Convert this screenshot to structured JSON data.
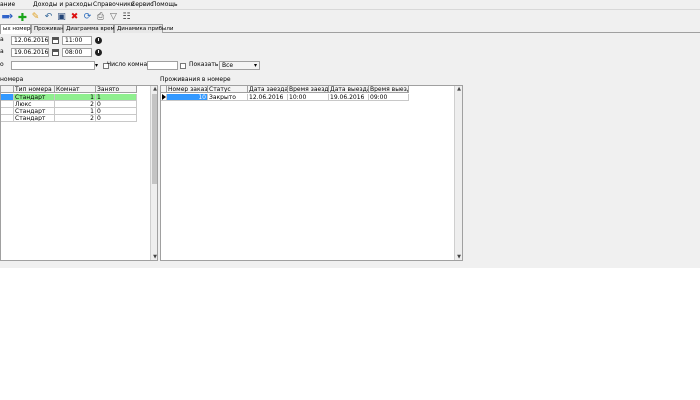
{
  "menu": [
    "ание",
    "Доходы и расходы",
    "Справочники",
    "Сервис",
    "Помощь"
  ],
  "tabs": [
    "ых номеров",
    "Проживание",
    "Диаграмма времени",
    "Динамика прибыли"
  ],
  "filters": {
    "checkin_label": "а",
    "checkin_date": "12.06.2016",
    "checkin_time": "11:00",
    "checkout_label": "а",
    "checkout_date": "19.06.2016",
    "checkout_time": "08:00",
    "row3_label": "о",
    "rooms_label": "Число комнат",
    "show_label": "Показать",
    "show_value": "Все"
  },
  "rooms_grid": {
    "title": "номера",
    "headers": [
      "",
      "Тип номера",
      "Комнат",
      "Занято"
    ],
    "rows": [
      [
        "",
        "Стандарт",
        "1",
        "1"
      ],
      [
        "",
        "Люкс",
        "2",
        "0"
      ],
      [
        "",
        "Стандарт",
        "1",
        "0"
      ],
      [
        "",
        "Стандарт",
        "2",
        "0"
      ]
    ]
  },
  "stays_grid": {
    "title": "Проживания в номере",
    "headers": [
      "Номер заказа",
      "Статус",
      "Дата заезда",
      "Время заезда",
      "Дата выезда",
      "Время выезда"
    ],
    "rows": [
      [
        "10",
        "Закрыто",
        "12.06.2016",
        "10:00",
        "19.06.2016",
        "09:00"
      ]
    ]
  }
}
